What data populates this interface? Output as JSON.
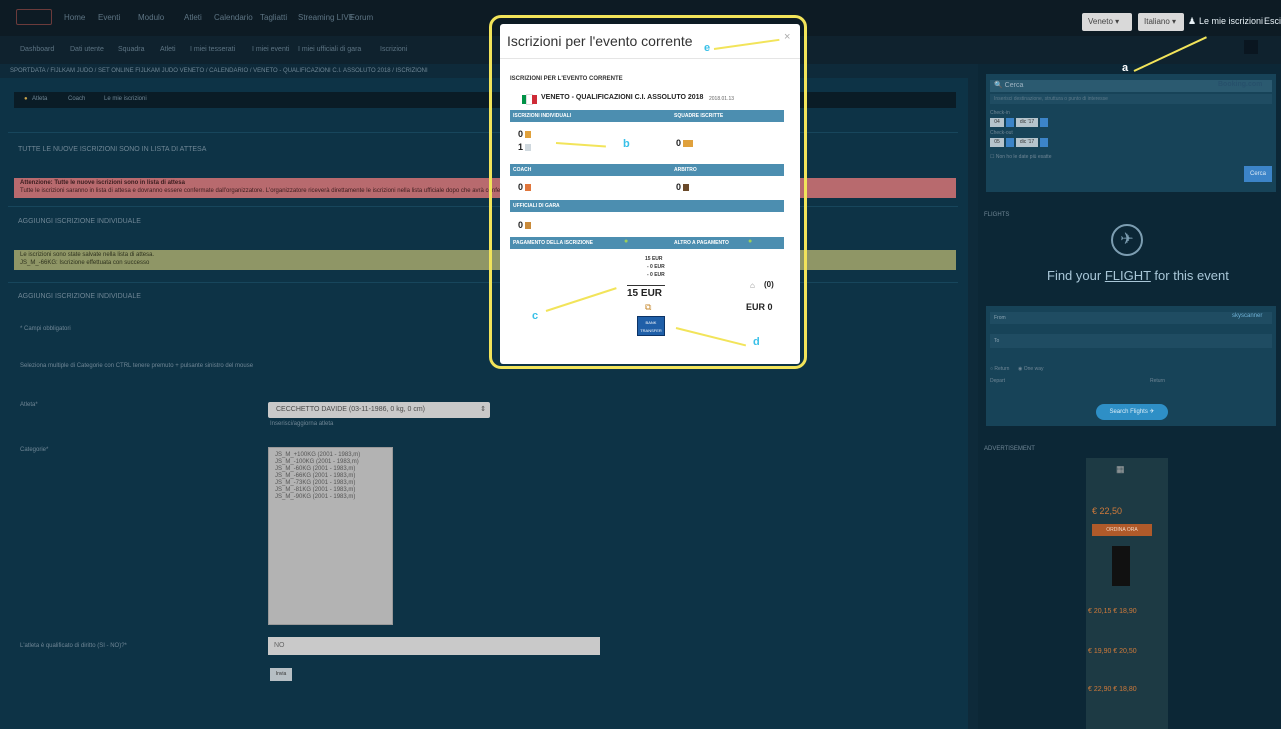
{
  "nav": {
    "items": [
      "Home",
      "Eventi",
      "Modulo",
      "Atleti",
      "Calendario",
      "Tagliatti",
      "Streaming LIVE",
      "Forum"
    ],
    "sub_items": [
      "Dashboard",
      "Dati utente",
      "Squadra",
      "Atleti",
      "I miei tesserati",
      "I miei eventi",
      "I miei ufficiali di gara",
      "Iscrizioni"
    ],
    "region_select": "Veneto",
    "language_select": "Italiano",
    "my_registrations": "Le mie iscrizioni",
    "exit": "Esci"
  },
  "breadcrumb": "SPORTDATA / FIJLKAM JUDO / SET ONLINE FIJLKAM JUDO VENETO / CALENDARIO / VENETO - QUALIFICAZIONI C.I. ASSOLUTO 2018 / ISCRIZIONI",
  "main": {
    "pillbar": {
      "atleta": "Atleta",
      "coach": "Coach",
      "mie": "Le mie iscrizioni"
    },
    "waiting_title": "TUTTE LE NUOVE ISCRIZIONI SONO IN LISTA DI ATTESA",
    "pink_line1": "Attenzione: Tutte le nuove iscrizioni sono in lista di attesa",
    "pink_line2": "Tutte le iscrizioni saranno in lista di attesa e dovranno essere confermate dall'organizzatore. L'organizzatore riceverà direttamente le iscrizioni nella lista ufficiale dopo che avrà confermato.",
    "add_title_1": "AGGIUNGI ISCRIZIONE INDIVIDUALE",
    "yellow_line1": "Le iscrizioni sono state salvate nella lista di attesa.",
    "yellow_line2": "JS_M_-66KG: Iscrizione effettuata con successo",
    "add_title_2": "AGGIUNGI ISCRIZIONE INDIVIDUALE",
    "required": "* Campi obbligatori",
    "multi_select_hint": "Seleziona multiple di Categorie con CTRL tenere premuto + pulsante sinistro del mouse",
    "atleta_label": "Atleta*",
    "atleta_value": "CECCHETTO DAVIDE (03-11-1986, 0 kg, 0 cm)",
    "atleta_refresh": "Inserisci/aggiorna atleta",
    "categorie_label": "Categorie*",
    "categories": [
      "JS_M_+100KG (2001 - 1983,m)",
      "JS_M_-100KG (2001 - 1983,m)",
      "JS_M_-60KG (2001 - 1983,m)",
      "JS_M_-66KG (2001 - 1983,m)",
      "JS_M_-73KG (2001 - 1983,m)",
      "JS_M_-81KG (2001 - 1983,m)",
      "JS_M_-90KG (2001 - 1983,m)"
    ],
    "qualified_label": "L'atleta è qualificato di diritto (SI - NO)?*",
    "qualified_value": "NO",
    "send_button": "Invia"
  },
  "sidebar": {
    "search_placeholder": "Cerca",
    "booking": "Booking.com",
    "search_sub": "Inserisci destinazione, struttura o punto di interesse",
    "checkin_label": "Check-in",
    "checkout_label": "Check-out",
    "checkin_day": "04",
    "checkin_month": "dic '17",
    "checkout_day": "05",
    "checkout_month": "dic '17",
    "no_dates": "Non ho le date più esatte",
    "search_btn": "Cerca",
    "flights_title": "FLIGHTS",
    "flight_text_pre": "Find your ",
    "flight_text_link": "FLIGHT",
    "flight_text_post": " for this event",
    "from_label": "From",
    "to_label": "To",
    "return": "Return",
    "one_way": "One way",
    "depart": "Depart",
    "return_label": "Return",
    "skyscanner": "skyscanner",
    "search_flights": "Search Flights",
    "ad_title": "ADVERTISEMENT",
    "ad_price1": "€ 22,50",
    "ad_cta": "ORDINA ORA",
    "ad_prices2": "€ 20,15   € 18,90",
    "ad_prices3": "€ 19,90   € 20,50",
    "ad_prices4": "€ 22,90   € 18,80"
  },
  "modal": {
    "title": "Iscrizioni per l'evento corrente",
    "close": "×",
    "subtitle": "ISCRIZIONI PER L'EVENTO CORRENTE",
    "event_name": "VENETO - QUALIFICAZIONI C.I. ASSOLUTO 2018",
    "event_date": "2018.01.13",
    "individual_header": "ISCRIZIONI INDIVIDUALI",
    "teams_header": "SQUADRE ISCRITTE",
    "individual_count": "0",
    "waiting_count": "1",
    "teams_count": "0",
    "coach_header": "COACH",
    "referee_header": "ARBITRO",
    "coach_count": "0",
    "referee_count": "0",
    "officials_header": "UFFICIALI DI GARA",
    "officials_count": "0",
    "payment_header": "PAGAMENTO DELLA ISCRIZIONE",
    "other_payment_header": "ALTRO A PAGAMENTO",
    "fee_line1": "15 EUR",
    "fee_line2": "- 0 EUR",
    "fee_line3": "- 0 EUR",
    "fee_total": "15 EUR",
    "other_count": "(0)",
    "other_total": "EUR 0",
    "bank_transfer": "BANK TRANSFER"
  },
  "annotations": {
    "a": "a",
    "b": "b",
    "c": "c",
    "d": "d",
    "e": "e"
  },
  "colors": {
    "highlight": "#f2e45a",
    "annotation_text": "#39c0e8",
    "modal_bar": "#4c8eb0"
  }
}
